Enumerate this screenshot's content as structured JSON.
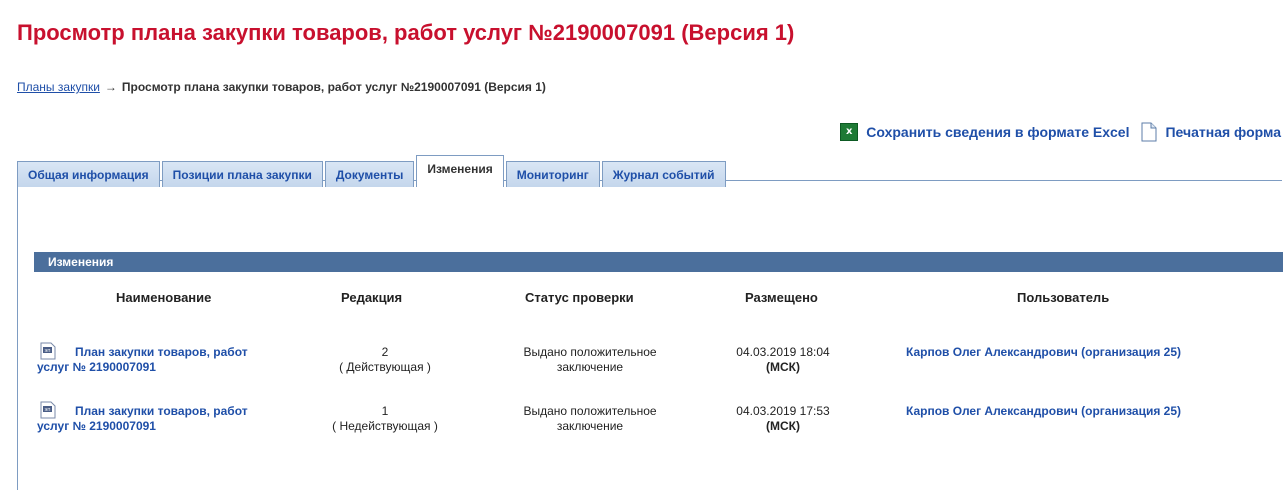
{
  "page_title": "Просмотр плана закупки товаров, работ услуг №2190007091 (Версия 1)",
  "breadcrumb": {
    "link": "Планы закупки",
    "arrow": "→",
    "current": "Просмотр плана закупки товаров, работ услуг №2190007091 (Версия 1)"
  },
  "actions": {
    "excel_label": "Сохранить сведения в формате Excel",
    "excel_icon_glyph": "x",
    "print_label": "Печатная форма"
  },
  "tabs": [
    {
      "label": "Общая информация"
    },
    {
      "label": "Позиции плана закупки"
    },
    {
      "label": "Документы"
    },
    {
      "label": "Изменения"
    },
    {
      "label": "Мониторинг"
    },
    {
      "label": "Журнал событий"
    }
  ],
  "section_title": "Изменения",
  "table": {
    "headers": {
      "name": "Наименование",
      "revision": "Редакция",
      "status": "Статус проверки",
      "posted": "Размещено",
      "user": "Пользователь"
    },
    "rows": [
      {
        "name_line1": "План закупки товаров, работ",
        "name_line2": "услуг № 2190007091",
        "revision_num": "2",
        "revision_state": "( Действующая )",
        "status_line1": "Выдано положительное",
        "status_line2": "заключение",
        "posted_datetime": "04.03.2019 18:04",
        "posted_tz": "(МСК)",
        "user": "Карпов Олег Александрович (организация 25)"
      },
      {
        "name_line1": "План закупки товаров, работ",
        "name_line2": "услуг № 2190007091",
        "revision_num": "1",
        "revision_state": "( Недействующая )",
        "status_line1": "Выдано положительное",
        "status_line2": "заключение",
        "posted_datetime": "04.03.2019 17:53",
        "posted_tz": "(МСК)",
        "user": "Карпов Олег Александрович (организация 25)"
      }
    ]
  },
  "colors": {
    "title_red": "#c8102e",
    "link_blue": "#1f4fa8",
    "section_header_bg": "#4b6f9c"
  }
}
